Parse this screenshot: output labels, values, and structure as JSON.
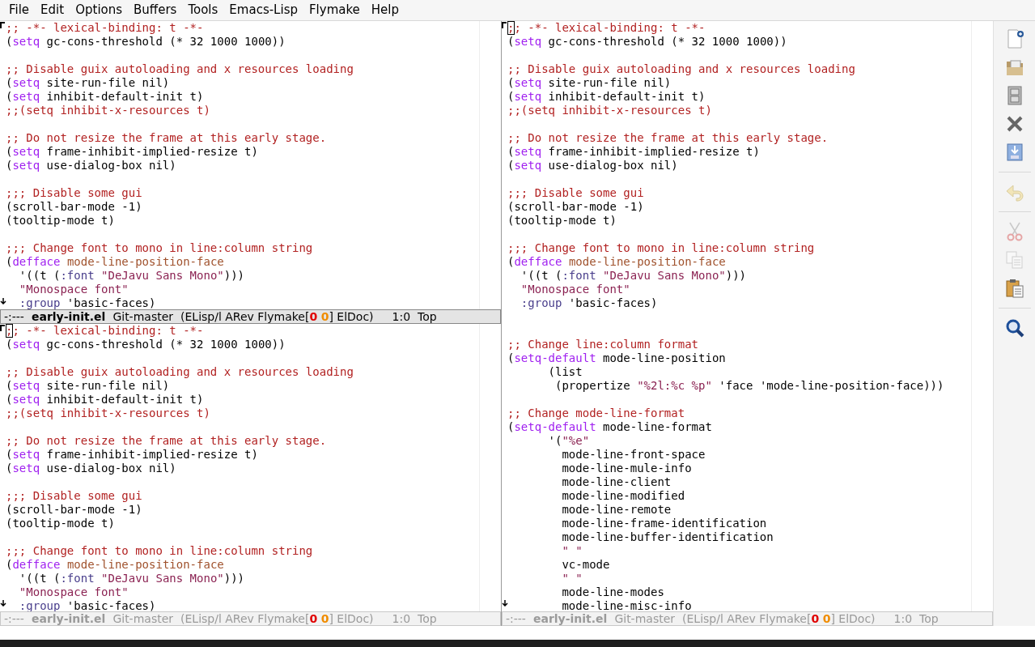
{
  "menu": [
    "File",
    "Edit",
    "Options",
    "Buffers",
    "Tools",
    "Emacs-Lisp",
    "Flymake",
    "Help"
  ],
  "left_windows": [
    {
      "active": true,
      "cursor_visible": false,
      "lines": [
        {
          "kind": "code",
          "tokens": [
            {
              "kind": "comment",
              "text": ";; -*- lexical-binding: t -*-"
            }
          ]
        },
        {
          "kind": "code",
          "tokens": [
            {
              "kind": "plain",
              "text": "("
            },
            {
              "kind": "keyword",
              "text": "setq"
            },
            {
              "kind": "plain",
              "text": " gc-cons-threshold (* 32 1000 1000))"
            }
          ]
        },
        {
          "kind": "blank"
        },
        {
          "kind": "code",
          "tokens": [
            {
              "kind": "comment",
              "text": ";; Disable guix autoloading and x resources loading"
            }
          ]
        },
        {
          "kind": "code",
          "tokens": [
            {
              "kind": "plain",
              "text": "("
            },
            {
              "kind": "keyword",
              "text": "setq"
            },
            {
              "kind": "plain",
              "text": " site-run-file nil)"
            }
          ]
        },
        {
          "kind": "code",
          "tokens": [
            {
              "kind": "plain",
              "text": "("
            },
            {
              "kind": "keyword",
              "text": "setq"
            },
            {
              "kind": "plain",
              "text": " inhibit-default-init t)"
            }
          ]
        },
        {
          "kind": "code",
          "tokens": [
            {
              "kind": "comment",
              "text": ";;(setq inhibit-x-resources t)"
            }
          ]
        },
        {
          "kind": "blank"
        },
        {
          "kind": "code",
          "tokens": [
            {
              "kind": "comment",
              "text": ";; Do not resize the frame at this early stage."
            }
          ]
        },
        {
          "kind": "code",
          "tokens": [
            {
              "kind": "plain",
              "text": "("
            },
            {
              "kind": "keyword",
              "text": "setq"
            },
            {
              "kind": "plain",
              "text": " frame-inhibit-implied-resize t)"
            }
          ]
        },
        {
          "kind": "code",
          "tokens": [
            {
              "kind": "plain",
              "text": "("
            },
            {
              "kind": "keyword",
              "text": "setq"
            },
            {
              "kind": "plain",
              "text": " use-dialog-box nil)"
            }
          ]
        },
        {
          "kind": "blank"
        },
        {
          "kind": "code",
          "tokens": [
            {
              "kind": "comment",
              "text": ";;; Disable some gui"
            }
          ]
        },
        {
          "kind": "code",
          "tokens": [
            {
              "kind": "plain",
              "text": "(scroll-bar-mode -1)"
            }
          ]
        },
        {
          "kind": "code",
          "tokens": [
            {
              "kind": "plain",
              "text": "(tooltip-mode t)"
            }
          ]
        },
        {
          "kind": "blank"
        },
        {
          "kind": "code",
          "tokens": [
            {
              "kind": "comment",
              "text": ";;; Change font to mono in line:column string"
            }
          ]
        },
        {
          "kind": "code",
          "tokens": [
            {
              "kind": "plain",
              "text": "("
            },
            {
              "kind": "keyword",
              "text": "defface"
            },
            {
              "kind": "function",
              "text": " mode-line-position-face"
            }
          ]
        },
        {
          "kind": "code",
          "tokens": [
            {
              "kind": "plain",
              "text": "  '((t ("
            },
            {
              "kind": "constant",
              "text": ":font"
            },
            {
              "kind": "string",
              "text": " \"DeJavu Sans Mono\""
            },
            {
              "kind": "plain",
              "text": ")))"
            }
          ]
        },
        {
          "kind": "code",
          "tokens": [
            {
              "kind": "string",
              "text": "  \"Monospace font\""
            }
          ]
        },
        {
          "kind": "code",
          "tokens": [
            {
              "kind": "constant",
              "text": "  :group"
            },
            {
              "kind": "plain",
              "text": " 'basic-faces)"
            }
          ]
        }
      ],
      "mode_line": {
        "status": "-:---",
        "buffer": "early-init.el",
        "vc": "Git-master",
        "modes_before": "(ELisp/l ARev Flymake[",
        "errors": "0",
        "warnings": "0",
        "modes_after": "] ElDoc)",
        "position": "1:0",
        "scroll": "Top"
      }
    },
    {
      "active": false,
      "cursor_visible": true,
      "lines": [
        {
          "kind": "code",
          "tokens": [
            {
              "kind": "comment",
              "text": ";; -*- lexical-binding: t -*-"
            }
          ]
        },
        {
          "kind": "code",
          "tokens": [
            {
              "kind": "plain",
              "text": "("
            },
            {
              "kind": "keyword",
              "text": "setq"
            },
            {
              "kind": "plain",
              "text": " gc-cons-threshold (* 32 1000 1000))"
            }
          ]
        },
        {
          "kind": "blank"
        },
        {
          "kind": "code",
          "tokens": [
            {
              "kind": "comment",
              "text": ";; Disable guix autoloading and x resources loading"
            }
          ]
        },
        {
          "kind": "code",
          "tokens": [
            {
              "kind": "plain",
              "text": "("
            },
            {
              "kind": "keyword",
              "text": "setq"
            },
            {
              "kind": "plain",
              "text": " site-run-file nil)"
            }
          ]
        },
        {
          "kind": "code",
          "tokens": [
            {
              "kind": "plain",
              "text": "("
            },
            {
              "kind": "keyword",
              "text": "setq"
            },
            {
              "kind": "plain",
              "text": " inhibit-default-init t)"
            }
          ]
        },
        {
          "kind": "code",
          "tokens": [
            {
              "kind": "comment",
              "text": ";;(setq inhibit-x-resources t)"
            }
          ]
        },
        {
          "kind": "blank"
        },
        {
          "kind": "code",
          "tokens": [
            {
              "kind": "comment",
              "text": ";; Do not resize the frame at this early stage."
            }
          ]
        },
        {
          "kind": "code",
          "tokens": [
            {
              "kind": "plain",
              "text": "("
            },
            {
              "kind": "keyword",
              "text": "setq"
            },
            {
              "kind": "plain",
              "text": " frame-inhibit-implied-resize t)"
            }
          ]
        },
        {
          "kind": "code",
          "tokens": [
            {
              "kind": "plain",
              "text": "("
            },
            {
              "kind": "keyword",
              "text": "setq"
            },
            {
              "kind": "plain",
              "text": " use-dialog-box nil)"
            }
          ]
        },
        {
          "kind": "blank"
        },
        {
          "kind": "code",
          "tokens": [
            {
              "kind": "comment",
              "text": ";;; Disable some gui"
            }
          ]
        },
        {
          "kind": "code",
          "tokens": [
            {
              "kind": "plain",
              "text": "(scroll-bar-mode -1)"
            }
          ]
        },
        {
          "kind": "code",
          "tokens": [
            {
              "kind": "plain",
              "text": "(tooltip-mode t)"
            }
          ]
        },
        {
          "kind": "blank"
        },
        {
          "kind": "code",
          "tokens": [
            {
              "kind": "comment",
              "text": ";;; Change font to mono in line:column string"
            }
          ]
        },
        {
          "kind": "code",
          "tokens": [
            {
              "kind": "plain",
              "text": "("
            },
            {
              "kind": "keyword",
              "text": "defface"
            },
            {
              "kind": "function",
              "text": " mode-line-position-face"
            }
          ]
        },
        {
          "kind": "code",
          "tokens": [
            {
              "kind": "plain",
              "text": "  '((t ("
            },
            {
              "kind": "constant",
              "text": ":font"
            },
            {
              "kind": "string",
              "text": " \"DeJavu Sans Mono\""
            },
            {
              "kind": "plain",
              "text": ")))"
            }
          ]
        },
        {
          "kind": "code",
          "tokens": [
            {
              "kind": "string",
              "text": "  \"Monospace font\""
            }
          ]
        },
        {
          "kind": "code",
          "tokens": [
            {
              "kind": "constant",
              "text": "  :group"
            },
            {
              "kind": "plain",
              "text": " 'basic-faces)"
            }
          ]
        }
      ],
      "mode_line": {
        "status": "-:---",
        "buffer": "early-init.el",
        "vc": "Git-master",
        "modes_before": "(ELisp/l ARev Flymake[",
        "errors": "0",
        "warnings": "0",
        "modes_after": "] ElDoc)",
        "position": "1:0",
        "scroll": "Top"
      }
    }
  ],
  "right_window": {
    "active": false,
    "cursor_visible": true,
    "lines": [
      {
        "kind": "code",
        "tokens": [
          {
            "kind": "comment",
            "text": ";; -*- lexical-binding: t -*-"
          }
        ]
      },
      {
        "kind": "code",
        "tokens": [
          {
            "kind": "plain",
            "text": "("
          },
          {
            "kind": "keyword",
            "text": "setq"
          },
          {
            "kind": "plain",
            "text": " gc-cons-threshold (* 32 1000 1000))"
          }
        ]
      },
      {
        "kind": "blank"
      },
      {
        "kind": "code",
        "tokens": [
          {
            "kind": "comment",
            "text": ";; Disable guix autoloading and x resources loading"
          }
        ]
      },
      {
        "kind": "code",
        "tokens": [
          {
            "kind": "plain",
            "text": "("
          },
          {
            "kind": "keyword",
            "text": "setq"
          },
          {
            "kind": "plain",
            "text": " site-run-file nil)"
          }
        ]
      },
      {
        "kind": "code",
        "tokens": [
          {
            "kind": "plain",
            "text": "("
          },
          {
            "kind": "keyword",
            "text": "setq"
          },
          {
            "kind": "plain",
            "text": " inhibit-default-init t)"
          }
        ]
      },
      {
        "kind": "code",
        "tokens": [
          {
            "kind": "comment",
            "text": ";;(setq inhibit-x-resources t)"
          }
        ]
      },
      {
        "kind": "blank"
      },
      {
        "kind": "code",
        "tokens": [
          {
            "kind": "comment",
            "text": ";; Do not resize the frame at this early stage."
          }
        ]
      },
      {
        "kind": "code",
        "tokens": [
          {
            "kind": "plain",
            "text": "("
          },
          {
            "kind": "keyword",
            "text": "setq"
          },
          {
            "kind": "plain",
            "text": " frame-inhibit-implied-resize t)"
          }
        ]
      },
      {
        "kind": "code",
        "tokens": [
          {
            "kind": "plain",
            "text": "("
          },
          {
            "kind": "keyword",
            "text": "setq"
          },
          {
            "kind": "plain",
            "text": " use-dialog-box nil)"
          }
        ]
      },
      {
        "kind": "blank"
      },
      {
        "kind": "code",
        "tokens": [
          {
            "kind": "comment",
            "text": ";;; Disable some gui"
          }
        ]
      },
      {
        "kind": "code",
        "tokens": [
          {
            "kind": "plain",
            "text": "(scroll-bar-mode -1)"
          }
        ]
      },
      {
        "kind": "code",
        "tokens": [
          {
            "kind": "plain",
            "text": "(tooltip-mode t)"
          }
        ]
      },
      {
        "kind": "blank"
      },
      {
        "kind": "code",
        "tokens": [
          {
            "kind": "comment",
            "text": ";;; Change font to mono in line:column string"
          }
        ]
      },
      {
        "kind": "code",
        "tokens": [
          {
            "kind": "plain",
            "text": "("
          },
          {
            "kind": "keyword",
            "text": "defface"
          },
          {
            "kind": "function",
            "text": " mode-line-position-face"
          }
        ]
      },
      {
        "kind": "code",
        "tokens": [
          {
            "kind": "plain",
            "text": "  '((t ("
          },
          {
            "kind": "constant",
            "text": ":font"
          },
          {
            "kind": "string",
            "text": " \"DeJavu Sans Mono\""
          },
          {
            "kind": "plain",
            "text": ")))"
          }
        ]
      },
      {
        "kind": "code",
        "tokens": [
          {
            "kind": "string",
            "text": "  \"Monospace font\""
          }
        ]
      },
      {
        "kind": "code",
        "tokens": [
          {
            "kind": "constant",
            "text": "  :group"
          },
          {
            "kind": "plain",
            "text": " 'basic-faces)"
          }
        ]
      },
      {
        "kind": "blank"
      },
      {
        "kind": "blank"
      },
      {
        "kind": "code",
        "tokens": [
          {
            "kind": "comment",
            "text": ";; Change line:column format"
          }
        ]
      },
      {
        "kind": "code",
        "tokens": [
          {
            "kind": "plain",
            "text": "("
          },
          {
            "kind": "keyword",
            "text": "setq-default"
          },
          {
            "kind": "plain",
            "text": " mode-line-position"
          }
        ]
      },
      {
        "kind": "code",
        "tokens": [
          {
            "kind": "plain",
            "text": "      (list"
          }
        ]
      },
      {
        "kind": "code",
        "tokens": [
          {
            "kind": "plain",
            "text": "       (propertize"
          },
          {
            "kind": "string",
            "text": " \"%2l:%c %p\""
          },
          {
            "kind": "plain",
            "text": " 'face 'mode-line-position-face)))"
          }
        ]
      },
      {
        "kind": "blank"
      },
      {
        "kind": "code",
        "tokens": [
          {
            "kind": "comment",
            "text": ";; Change mode-line-format"
          }
        ]
      },
      {
        "kind": "code",
        "tokens": [
          {
            "kind": "plain",
            "text": "("
          },
          {
            "kind": "keyword",
            "text": "setq-default"
          },
          {
            "kind": "plain",
            "text": " mode-line-format"
          }
        ]
      },
      {
        "kind": "code",
        "tokens": [
          {
            "kind": "plain",
            "text": "      '("
          },
          {
            "kind": "string",
            "text": "\"%e\""
          }
        ]
      },
      {
        "kind": "code",
        "tokens": [
          {
            "kind": "plain",
            "text": "        mode-line-front-space"
          }
        ]
      },
      {
        "kind": "code",
        "tokens": [
          {
            "kind": "plain",
            "text": "        mode-line-mule-info"
          }
        ]
      },
      {
        "kind": "code",
        "tokens": [
          {
            "kind": "plain",
            "text": "        mode-line-client"
          }
        ]
      },
      {
        "kind": "code",
        "tokens": [
          {
            "kind": "plain",
            "text": "        mode-line-modified"
          }
        ]
      },
      {
        "kind": "code",
        "tokens": [
          {
            "kind": "plain",
            "text": "        mode-line-remote"
          }
        ]
      },
      {
        "kind": "code",
        "tokens": [
          {
            "kind": "plain",
            "text": "        mode-line-frame-identification"
          }
        ]
      },
      {
        "kind": "code",
        "tokens": [
          {
            "kind": "plain",
            "text": "        mode-line-buffer-identification"
          }
        ]
      },
      {
        "kind": "code",
        "tokens": [
          {
            "kind": "string",
            "text": "        \" \""
          }
        ]
      },
      {
        "kind": "code",
        "tokens": [
          {
            "kind": "plain",
            "text": "        vc-mode"
          }
        ]
      },
      {
        "kind": "code",
        "tokens": [
          {
            "kind": "string",
            "text": "        \" \""
          }
        ]
      },
      {
        "kind": "code",
        "tokens": [
          {
            "kind": "plain",
            "text": "        mode-line-modes"
          }
        ]
      },
      {
        "kind": "code",
        "tokens": [
          {
            "kind": "plain",
            "text": "        mode-line-misc-info"
          }
        ]
      }
    ],
    "mode_line": {
      "status": "-:---",
      "buffer": "early-init.el",
      "vc": "Git-master",
      "modes_before": "(ELisp/l ARev Flymake[",
      "errors": "0",
      "warnings": "0",
      "modes_after": "] ElDoc)",
      "position": "1:0",
      "scroll": "Top"
    }
  },
  "toolbar": [
    [
      {
        "kind": "new",
        "disabled": false
      },
      {
        "kind": "open",
        "disabled": false
      },
      {
        "kind": "dired",
        "disabled": false
      },
      {
        "kind": "close",
        "disabled": false
      },
      {
        "kind": "save",
        "disabled": false
      }
    ],
    [
      {
        "kind": "undo",
        "disabled": true
      }
    ],
    [
      {
        "kind": "cut",
        "disabled": true
      },
      {
        "kind": "copy",
        "disabled": true
      },
      {
        "kind": "paste",
        "disabled": false
      }
    ],
    [
      {
        "kind": "search",
        "disabled": false
      }
    ]
  ]
}
